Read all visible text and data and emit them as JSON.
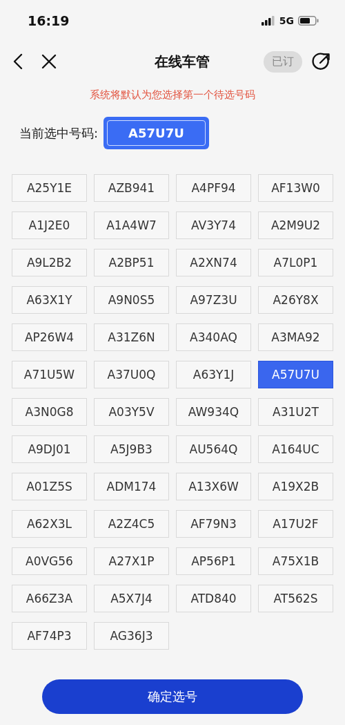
{
  "status_bar": {
    "time": "16:19",
    "network": "5G"
  },
  "header": {
    "title": "在线车管",
    "badge": "已订"
  },
  "notice": "系统将默认为您选择第一个待选号码",
  "current": {
    "label": "当前选中号码:",
    "value": "A57U7U"
  },
  "numbers": [
    {
      "text": "A25Y1E",
      "selected": false
    },
    {
      "text": "AZB941",
      "selected": false
    },
    {
      "text": "A4PF94",
      "selected": false
    },
    {
      "text": "AF13W0",
      "selected": false
    },
    {
      "text": "A1J2E0",
      "selected": false
    },
    {
      "text": "A1A4W7",
      "selected": false
    },
    {
      "text": "AV3Y74",
      "selected": false
    },
    {
      "text": "A2M9U2",
      "selected": false
    },
    {
      "text": "A9L2B2",
      "selected": false
    },
    {
      "text": "A2BP51",
      "selected": false
    },
    {
      "text": "A2XN74",
      "selected": false
    },
    {
      "text": "A7L0P1",
      "selected": false
    },
    {
      "text": "A63X1Y",
      "selected": false
    },
    {
      "text": "A9N0S5",
      "selected": false
    },
    {
      "text": "A97Z3U",
      "selected": false
    },
    {
      "text": "A26Y8X",
      "selected": false
    },
    {
      "text": "AP26W4",
      "selected": false
    },
    {
      "text": "A31Z6N",
      "selected": false
    },
    {
      "text": "A340AQ",
      "selected": false
    },
    {
      "text": "A3MA92",
      "selected": false
    },
    {
      "text": "A71U5W",
      "selected": false
    },
    {
      "text": "A37U0Q",
      "selected": false
    },
    {
      "text": "A63Y1J",
      "selected": false
    },
    {
      "text": "A57U7U",
      "selected": true
    },
    {
      "text": "A3N0G8",
      "selected": false
    },
    {
      "text": "A03Y5V",
      "selected": false
    },
    {
      "text": "AW934Q",
      "selected": false
    },
    {
      "text": "A31U2T",
      "selected": false
    },
    {
      "text": "A9DJ01",
      "selected": false
    },
    {
      "text": "A5J9B3",
      "selected": false
    },
    {
      "text": "AU564Q",
      "selected": false
    },
    {
      "text": "A164UC",
      "selected": false
    },
    {
      "text": "A01Z5S",
      "selected": false
    },
    {
      "text": "ADM174",
      "selected": false
    },
    {
      "text": "A13X6W",
      "selected": false
    },
    {
      "text": "A19X2B",
      "selected": false
    },
    {
      "text": "A62X3L",
      "selected": false
    },
    {
      "text": "A2Z4C5",
      "selected": false
    },
    {
      "text": "AF79N3",
      "selected": false
    },
    {
      "text": "A17U2F",
      "selected": false
    },
    {
      "text": "A0VG56",
      "selected": false
    },
    {
      "text": "A27X1P",
      "selected": false
    },
    {
      "text": "AP56P1",
      "selected": false
    },
    {
      "text": "A75X1B",
      "selected": false
    },
    {
      "text": "A66Z3A",
      "selected": false
    },
    {
      "text": "A5X7J4",
      "selected": false
    },
    {
      "text": "ATD840",
      "selected": false
    },
    {
      "text": "AT562S",
      "selected": false
    },
    {
      "text": "AF74P3",
      "selected": false
    },
    {
      "text": "AG36J3",
      "selected": false
    }
  ],
  "confirm_button": "确定选号"
}
